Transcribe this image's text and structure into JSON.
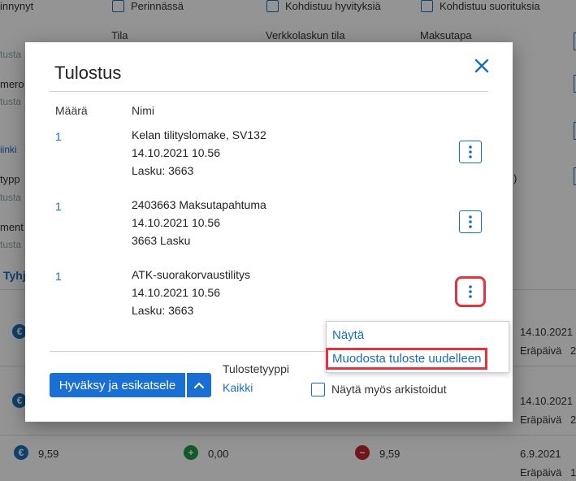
{
  "background": {
    "checkboxes": [
      {
        "label": "Perinnässä"
      },
      {
        "label": "Kohdistuu hyvityksiä"
      },
      {
        "label": "Kohdistuu suorituksia"
      }
    ],
    "left_partial": [
      "innynyt",
      "tusta",
      "mero",
      "tusta",
      "iinki",
      "typp",
      "tusta",
      "ment",
      "tusta",
      "Tyhj"
    ],
    "filter_labels": [
      "Tila",
      "Verkkolaskun tila",
      "Maksutapa"
    ],
    "right_fragment": ")",
    "rows": [
      {
        "date": "14.10.2021",
        "due_label": "Eräpäivä",
        "due_partial": "2"
      },
      {
        "date": "14.10.2021",
        "due_label": "Eräpäivä",
        "due_partial": "2"
      },
      {
        "amount1": "9,59",
        "amount2": "0,00",
        "amount3": "9,59",
        "date": "6.9.2021",
        "due_label": "Eräpäivä",
        "due_partial": "1"
      }
    ]
  },
  "dialog": {
    "title": "Tulostus",
    "columns": {
      "quantity": "Määrä",
      "name": "Nimi"
    },
    "items": [
      {
        "quantity": "1",
        "lines": [
          "Kelan tilityslomake, SV132",
          "14.10.2021 10.56",
          "Lasku: 3663"
        ]
      },
      {
        "quantity": "1",
        "lines": [
          "2403663 Maksutapahtuma",
          "14.10.2021 10.56",
          "3663 Lasku"
        ]
      },
      {
        "quantity": "1",
        "lines": [
          "ATK-suorakorvaustilitys",
          "14.10.2021 10.56",
          "Lasku: 3663"
        ]
      }
    ],
    "context_menu": {
      "items": [
        "Näytä",
        "Muodosta tuloste uudelleen"
      ]
    },
    "footer": {
      "primary_button": "Hyväksy ja esikatsele",
      "print_type_label": "Tulostetyyppi",
      "print_type_value": "Kaikki",
      "show_archived_label": "Näytä myös arkistoidut"
    }
  },
  "colors": {
    "accent": "#1a6fd4",
    "link": "#1a6fb8",
    "highlight": "#e0343e",
    "euro": "#1a6fb8",
    "plus": "#1f9a4a",
    "minus": "#c0282e"
  }
}
